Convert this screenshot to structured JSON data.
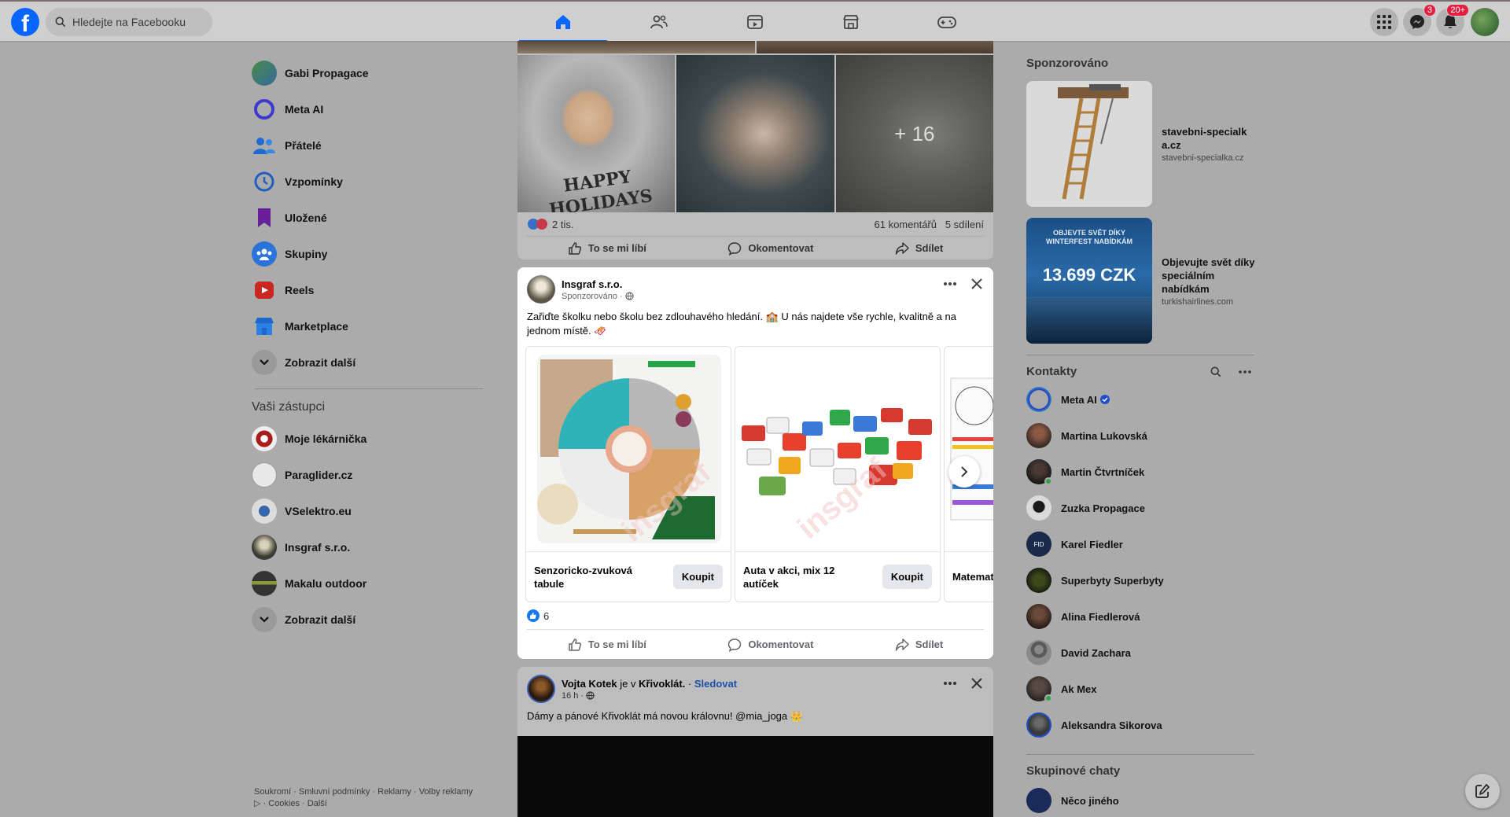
{
  "search": {
    "placeholder": "Hledejte na Facebooku"
  },
  "header": {
    "tabs": [
      "home",
      "friends",
      "watch",
      "marketplace",
      "gaming"
    ],
    "messenger_badge": "3",
    "notifications_badge": "20+"
  },
  "left_nav": {
    "items": [
      {
        "label": "Gabi Propagace",
        "icon": "profile-avatar"
      },
      {
        "label": "Meta AI",
        "icon": "meta-ai-icon"
      },
      {
        "label": "Přátelé",
        "icon": "friends-icon"
      },
      {
        "label": "Vzpomínky",
        "icon": "memories-icon"
      },
      {
        "label": "Uložené",
        "icon": "saved-icon"
      },
      {
        "label": "Skupiny",
        "icon": "groups-icon"
      },
      {
        "label": "Reels",
        "icon": "reels-icon"
      },
      {
        "label": "Marketplace",
        "icon": "marketplace-icon"
      },
      {
        "label": "Zobrazit další",
        "icon": "chevron-down-icon"
      }
    ],
    "shortcuts_heading": "Vaši zástupci",
    "shortcuts": [
      {
        "label": "Moje lékárnička"
      },
      {
        "label": "Paraglider.cz"
      },
      {
        "label": "VSelektro.eu"
      },
      {
        "label": "Insgraf s.r.o."
      },
      {
        "label": "Makalu outdoor"
      },
      {
        "label": "Zobrazit další"
      }
    ],
    "footer": {
      "privacy": "Soukromí",
      "terms": "Smluvní podmínky",
      "ads": "Reklamy",
      "ad_choices": "Volby reklamy",
      "cookies": "Cookies",
      "more": "Další"
    }
  },
  "post1": {
    "photo_more": "+ 16",
    "reactions": "2 tis.",
    "comments": "61 komentářů",
    "shares": "5 sdílení",
    "like": "To se mi líbí",
    "comment": "Okomentovat",
    "share": "Sdílet"
  },
  "post2": {
    "author": "Insgraf s.r.o.",
    "sponsored": "Sponzorováno",
    "text": "Zařiďte školku nebo školu bez zdlouhavého hledání. 🏫 U nás najdete vše rychle, kvalitně a na jednom místě. 🛷",
    "products": [
      {
        "title": "Senzoricko-zvuková tabule",
        "button": "Koupit"
      },
      {
        "title": "Auta v akci, mix 12 autíček",
        "button": "Koupit"
      },
      {
        "title": "Matematické karty",
        "button": ""
      }
    ],
    "reactions": "6",
    "like": "To se mi líbí",
    "comment": "Okomentovat",
    "share": "Sdílet"
  },
  "post3": {
    "author": "Vojta Kotek",
    "is_in": "je v",
    "place": "Křivoklát.",
    "follow": "Sledovat",
    "time": "16 h",
    "text": "Dámy a pánové Křivoklát má novou královnu! @mia_joga 👑"
  },
  "right": {
    "sponsored_heading": "Sponzorováno",
    "ads": [
      {
        "title": "stavebni-specialka.cz",
        "domain": "stavebni-specialka.cz"
      },
      {
        "title": "Objevujte svět díky speciálním nabídkám",
        "domain": "turkishairlines.com",
        "img_line1": "OBJEVTE SVĚT DÍKY",
        "img_line2": "WINTERFEST NABÍDKÁM",
        "img_price": "13.699 CZK"
      }
    ],
    "contacts_heading": "Kontakty",
    "contacts": [
      {
        "name": "Meta AI",
        "verified": true
      },
      {
        "name": "Martina Lukovská",
        "online": false
      },
      {
        "name": "Martin Čtvrtníček",
        "online": true
      },
      {
        "name": "Zuzka Propagace",
        "online": false
      },
      {
        "name": "Karel Fiedler",
        "online": false
      },
      {
        "name": "Superbyty Superbyty",
        "online": false
      },
      {
        "name": "Alina Fiedlerová",
        "online": false
      },
      {
        "name": "David Zachara",
        "online": false
      },
      {
        "name": "Ak Mex",
        "online": true
      },
      {
        "name": "Aleksandra Sikorova",
        "online": false
      }
    ],
    "group_chats_heading": "Skupinové chaty",
    "group_chats": [
      {
        "name": "Něco jiného"
      }
    ]
  }
}
